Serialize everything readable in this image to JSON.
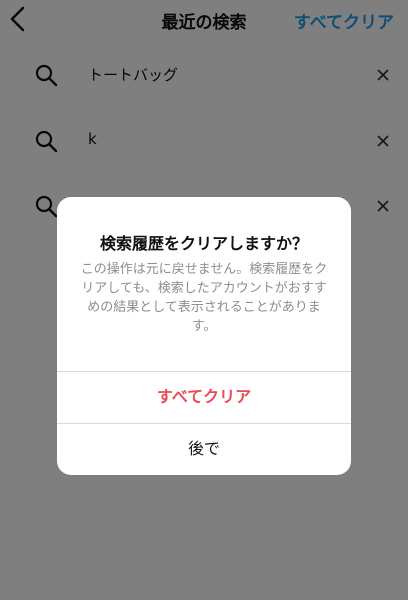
{
  "header": {
    "title": "最近の検索",
    "clear_all": "すべてクリア"
  },
  "history": [
    {
      "text": "トートバッグ"
    },
    {
      "text": "k"
    },
    {
      "text": ""
    }
  ],
  "dialog": {
    "title": "検索履歴をクリアしますか？",
    "message": "この操作は元に戻せません。検索履歴をクリアしても、検索したアカウントがおすすめの結果として表示されることがあります。",
    "confirm_label": "すべてクリア",
    "cancel_label": "後で"
  },
  "colors": {
    "accent_link": "#1f9aee",
    "destructive": "#ed4956"
  },
  "icons": [
    "back-icon",
    "search-icon",
    "close-icon"
  ]
}
